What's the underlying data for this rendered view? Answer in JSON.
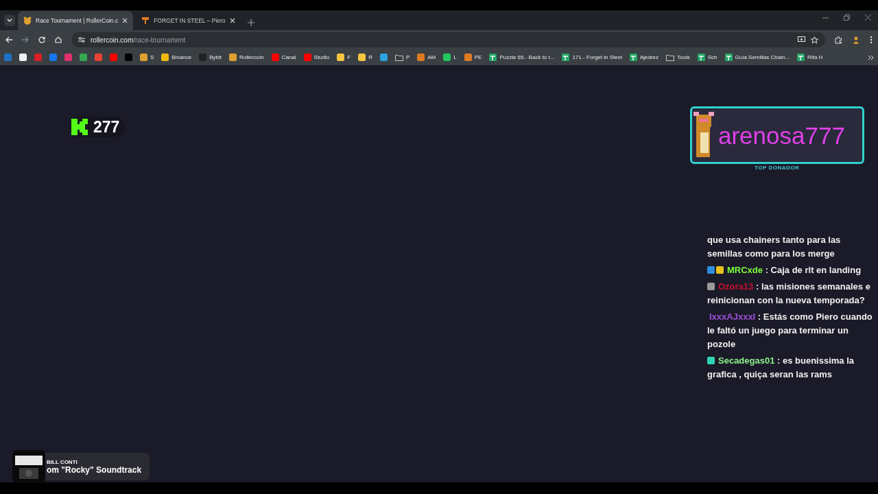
{
  "tabs": [
    {
      "title": "Race Tournament | RollerCoin.c",
      "kind": "roller",
      "selected": true
    },
    {
      "title": "FORGET IN STEEL – Piero",
      "kind": "steel",
      "selected": false
    }
  ],
  "address": {
    "domain": "rollercoin.com",
    "path": "/race-tournament"
  },
  "bookmarks": [
    {
      "kind": "site",
      "color": "#1e73c8"
    },
    {
      "kind": "site",
      "color": "#f0f0f0"
    },
    {
      "kind": "site",
      "color": "#d81f26"
    },
    {
      "kind": "site",
      "color": "#1877f2"
    },
    {
      "kind": "site",
      "color": "#e1306c"
    },
    {
      "kind": "site",
      "color": "#34a853"
    },
    {
      "kind": "site",
      "color": "#ea4335"
    },
    {
      "kind": "site",
      "color": "#ff0000"
    },
    {
      "kind": "site",
      "color": "#000000"
    },
    {
      "label": "S",
      "kind": "site",
      "color": "#e0a030"
    },
    {
      "label": "Binance",
      "kind": "site",
      "color": "#f0b90b"
    },
    {
      "label": "Bybit",
      "kind": "site",
      "color": "#222222"
    },
    {
      "label": "Rollercoin",
      "kind": "site",
      "color": "#e0a030"
    },
    {
      "label": "Canal",
      "kind": "site",
      "color": "#ff0000"
    },
    {
      "label": "Studio",
      "kind": "site",
      "color": "#ff0000"
    },
    {
      "label": "F",
      "kind": "site",
      "color": "#f5c542"
    },
    {
      "label": "R",
      "kind": "site",
      "color": "#f5c542"
    },
    {
      "kind": "site",
      "color": "#2aa3e0"
    },
    {
      "label": "P",
      "kind": "folder",
      "color": "#c4c7c5"
    },
    {
      "label": "AM",
      "kind": "site",
      "color": "#e07a20"
    },
    {
      "label": "L",
      "kind": "site",
      "color": "#22c55e"
    },
    {
      "label": "PE",
      "kind": "site",
      "color": "#e07a20"
    },
    {
      "label": "Puzzle 65.- Back to t...",
      "kind": "sheet",
      "color": "#23a566"
    },
    {
      "label": "171.- Forget in Steel",
      "kind": "sheet",
      "color": "#23a566"
    },
    {
      "label": "Ajedrez",
      "kind": "sheet",
      "color": "#23a566"
    },
    {
      "label": "Tools",
      "kind": "folder",
      "color": "#c4c7c5"
    },
    {
      "label": "Sch",
      "kind": "sheet",
      "color": "#23a566"
    },
    {
      "label": "Guía Semillas Chain...",
      "kind": "sheet",
      "color": "#23a566"
    },
    {
      "label": "Rifa H",
      "kind": "sheet",
      "color": "#23a566"
    }
  ],
  "points": {
    "value": "277"
  },
  "top_donor": {
    "name": "arenosa777",
    "caption": "TOP DONADOR"
  },
  "chat": [
    {
      "text": "que usa chainers tanto para las semillas como para los merge"
    },
    {
      "user": "MRCxde",
      "color": "#7cfc3c",
      "separator": ":",
      "text": "Caja de rlt en landing",
      "badges": [
        {
          "color": "#2d8ee0"
        },
        {
          "color": "#e8c21e"
        }
      ]
    },
    {
      "user": "Ozora13",
      "color": "#c8102e",
      "separator": ":",
      "text": "las misiones semanales e reinicionan con la nueva temporada?",
      "badges": [
        {
          "color": "#9a9a9a"
        }
      ]
    },
    {
      "user": "IxxxAJxxxI",
      "color": "#9b4fd9",
      "separator": ":",
      "text": "Estás como Piero cuando le faltó un juego para terminar un pozole"
    },
    {
      "user": "Secadegas01",
      "color": "#8ef08e",
      "separator": ":",
      "text": "es buenissima la grafica , quiça seran las rams",
      "badges": [
        {
          "color": "#2fd3b5"
        }
      ]
    }
  ],
  "now_playing": {
    "artist": "BILL CONTI",
    "title": "om \"Rocky\" Soundtrack"
  }
}
